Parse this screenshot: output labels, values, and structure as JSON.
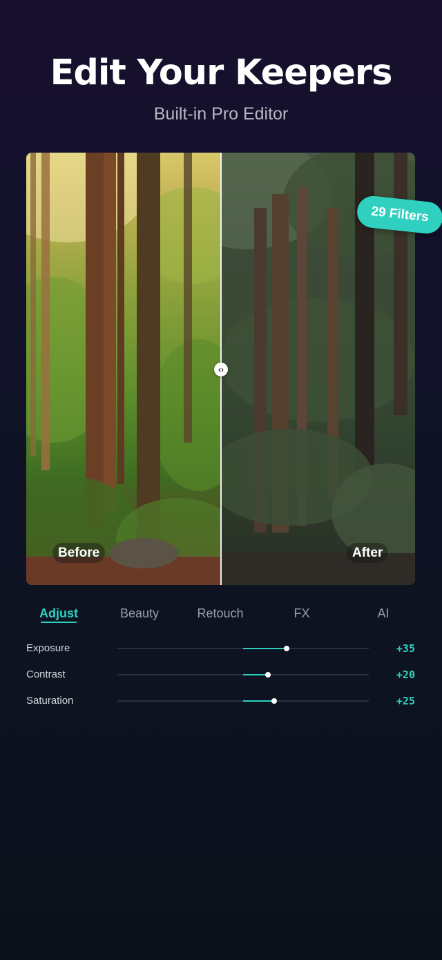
{
  "header": {
    "title": "Edit Your Keepers",
    "subtitle": "Built-in Pro Editor"
  },
  "comparison": {
    "before_label": "Before",
    "after_label": "After",
    "badge": "29 Filters",
    "divider_handle_icon": "left-right-arrows-icon"
  },
  "tabs": [
    {
      "label": "Adjust",
      "active": true
    },
    {
      "label": "Beauty",
      "active": false
    },
    {
      "label": "Retouch",
      "active": false
    },
    {
      "label": "FX",
      "active": false
    },
    {
      "label": "AI",
      "active": false
    }
  ],
  "sliders": [
    {
      "label": "Exposure",
      "value_text": "+35",
      "value": 35
    },
    {
      "label": "Contrast",
      "value_text": "+20",
      "value": 20
    },
    {
      "label": "Saturation",
      "value_text": "+25",
      "value": 25
    }
  ],
  "colors": {
    "accent": "#2fd0bf",
    "background": "#0d1320",
    "muted_text": "#9aa0a9"
  }
}
